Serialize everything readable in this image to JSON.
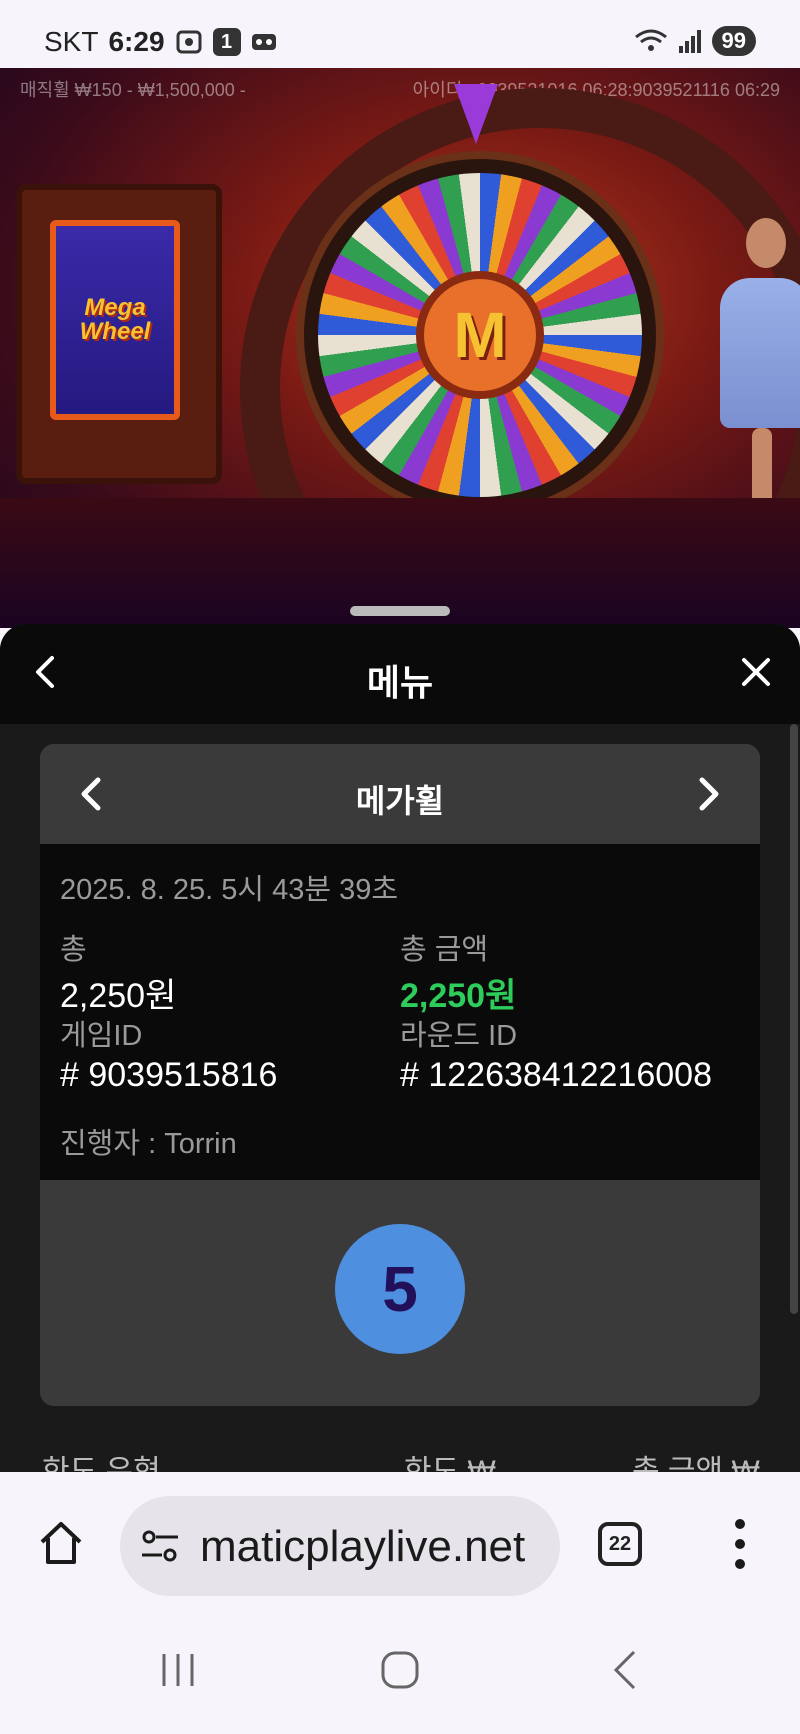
{
  "status_bar": {
    "carrier": "SKT",
    "time": "6:29",
    "notification_count": "1",
    "battery": "99"
  },
  "video": {
    "bet_range": "매직휠 ₩150 - ₩1,500,000 -",
    "session_info": "아이디 : 9039521016 06:28:9039521116  06:29",
    "panel_logo_line1": "Mega",
    "panel_logo_line2": "Wheel",
    "wheel_hub_letter": "M"
  },
  "menu": {
    "title": "메뉴",
    "game_card": {
      "game_name": "메가휠",
      "datetime": "2025. 8. 25. 5시 43분 39초",
      "total_label": "총",
      "total_value": "2,250원",
      "total_amount_label": "총 금액",
      "total_amount_value": "2,250원",
      "game_id_label": "게임ID",
      "game_id_value": "# 9039515816",
      "round_id_label": "라운드 ID",
      "round_id_value": "# 122638412216008",
      "dealer": "진행자 : Torrin",
      "result": "5"
    },
    "table_header": {
      "col1": "한도 유형",
      "col2": "한도 ₩",
      "col3": "총 금액 ₩"
    }
  },
  "browser": {
    "url": "maticplaylive.net",
    "tab_count": "22"
  },
  "colors": {
    "accent_green": "#2ecc5a",
    "result_ball": "#4e8fe0"
  }
}
